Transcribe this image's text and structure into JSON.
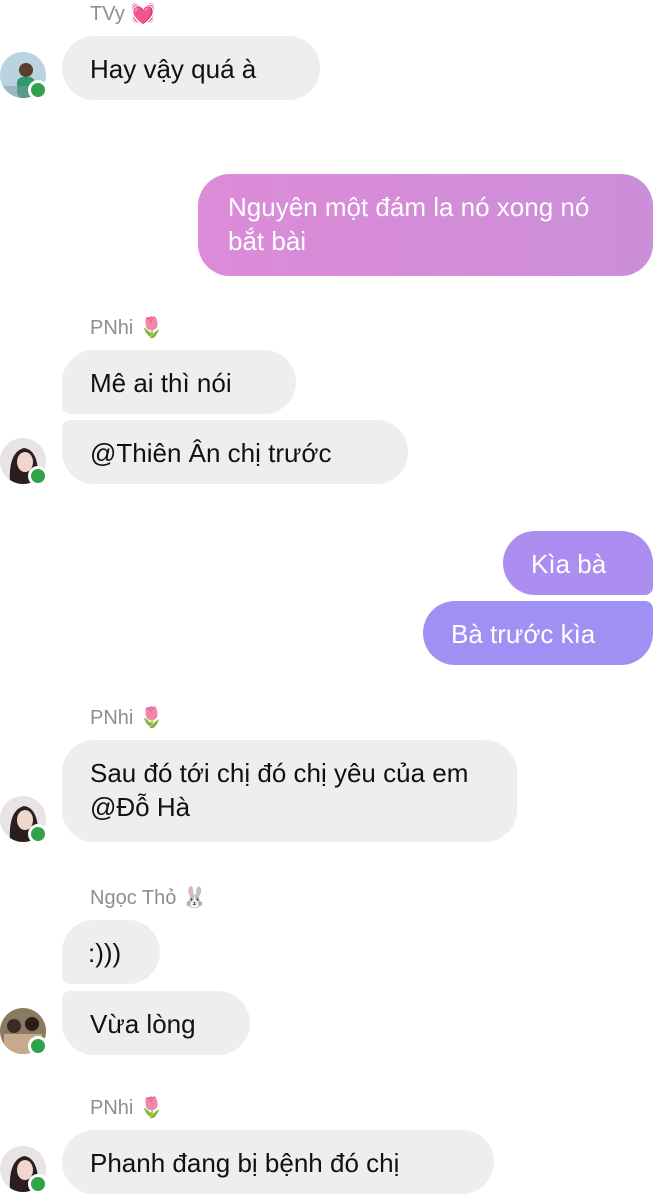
{
  "messages": [
    {
      "sender": "TVy",
      "sender_emoji": "💓",
      "text": "Hay vậy quá à"
    },
    {
      "sender": "me",
      "text": "Nguyên một đám la nó xong nó bắt bài"
    },
    {
      "sender": "PNhi",
      "sender_emoji": "🌷",
      "text": "Mê ai thì nói"
    },
    {
      "sender": "PNhi",
      "text": "@Thiên Ân chị trước"
    },
    {
      "sender": "me",
      "text": "Kìa bà"
    },
    {
      "sender": "me",
      "text": "Bà trước kìa"
    },
    {
      "sender": "PNhi",
      "sender_emoji": "🌷",
      "text": "Sau đó tới chị đó chị yêu của em @Đỗ Hà"
    },
    {
      "sender": "Ngọc Thỏ",
      "sender_emoji": "🐰",
      "text": ":)))"
    },
    {
      "sender": "Ngọc Thỏ",
      "text": "Vừa lòng"
    },
    {
      "sender": "PNhi",
      "sender_emoji": "🌷",
      "text": "Phanh đang bị bệnh đó chị"
    }
  ],
  "colors": {
    "incoming_bubble": "#eeeeee",
    "outgoing_pink": "#d28ad6",
    "outgoing_purple": "#a58ef2",
    "online_dot": "#31a24c",
    "sender_name": "#8e8e8e"
  }
}
